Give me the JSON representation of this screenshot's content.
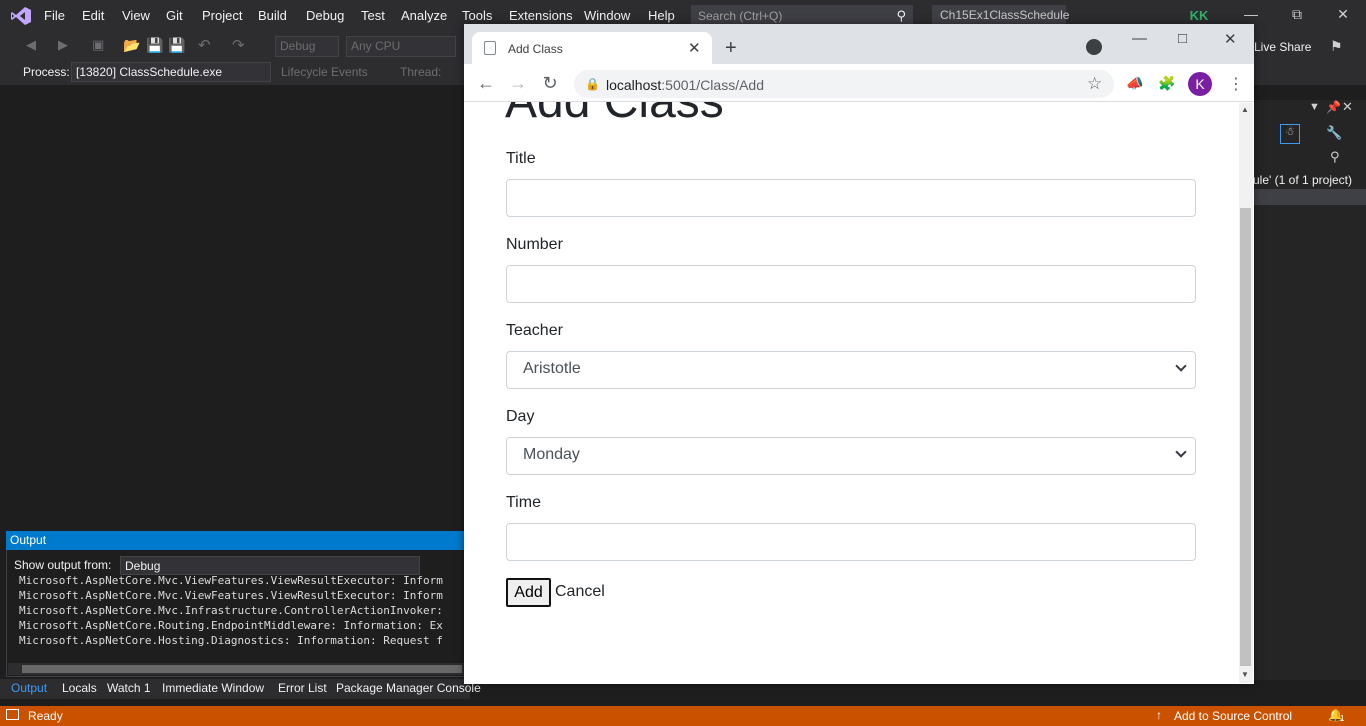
{
  "vs": {
    "menu": [
      "File",
      "Edit",
      "View",
      "Git",
      "Project",
      "Build",
      "Debug",
      "Test",
      "Analyze",
      "Tools",
      "Extensions",
      "Window",
      "Help"
    ],
    "search_placeholder": "Search (Ctrl+Q)",
    "project_name": "Ch15Ex1ClassSchedule",
    "user_initials": "KK",
    "config_dropdown": "Debug",
    "platform_dropdown": "Any CPU",
    "live_share": "Live Share",
    "process_label": "Process:",
    "process_value": "[13820] ClassSchedule.exe",
    "lifecycle_events": "Lifecycle Events",
    "thread_label": "Thread:",
    "right_pane_summary": "ule' (1 of 1 project)",
    "output": {
      "title": "Output",
      "show_from_label": "Show output from:",
      "source": "Debug",
      "lines": [
        "Microsoft.AspNetCore.Mvc.ViewFeatures.ViewResultExecutor: Inform",
        "Microsoft.AspNetCore.Mvc.ViewFeatures.ViewResultExecutor: Inform",
        "Microsoft.AspNetCore.Mvc.Infrastructure.ControllerActionInvoker:",
        "Microsoft.AspNetCore.Routing.EndpointMiddleware: Information: Ex",
        "Microsoft.AspNetCore.Hosting.Diagnostics: Information: Request f"
      ]
    },
    "bottom_tabs": [
      "Output",
      "Locals",
      "Watch 1",
      "Immediate Window",
      "Error List",
      "Package Manager Console"
    ],
    "status_ready": "Ready",
    "status_source_control": "Add to Source Control",
    "notification_count": "1"
  },
  "browser": {
    "tab_title": "Add Class",
    "url_host": "localhost",
    "url_rest": ":5001/Class/Add",
    "profile_initial": "K"
  },
  "page": {
    "heading": "Add Class",
    "fields": {
      "title_label": "Title",
      "number_label": "Number",
      "teacher_label": "Teacher",
      "teacher_value": "Aristotle",
      "day_label": "Day",
      "day_value": "Monday",
      "time_label": "Time"
    },
    "add_button": "Add",
    "cancel_link": "Cancel"
  },
  "colors": {
    "vs_background": "#1e1e1e",
    "vs_accent": "#007acc",
    "status_bar": "#ca5100",
    "profile_avatar": "#7b1fa2"
  }
}
